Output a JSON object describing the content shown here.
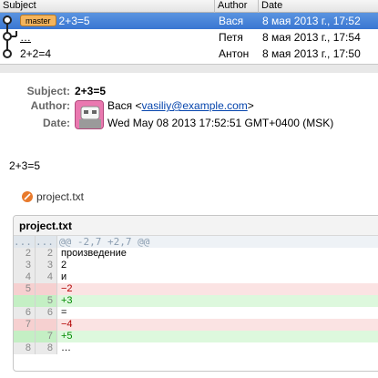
{
  "header": {
    "subject": "Subject",
    "author": "Author",
    "date": "Date"
  },
  "commits": [
    {
      "branch": "master",
      "subject": "2+3=5",
      "author": "Вася",
      "date": "8 мая 2013 г., 17:52"
    },
    {
      "subject": "…",
      "author": "Петя",
      "date": "8 мая 2013 г., 17:54"
    },
    {
      "subject": "2+2=4",
      "author": "Антон",
      "date": "8 мая 2013 г., 17:50"
    }
  ],
  "details": {
    "subject_label": "Subject:",
    "subject": "2+3=5",
    "author_label": "Author:",
    "author_name": "Вася <",
    "author_email": "vasiliy@example.com",
    "author_close": ">",
    "date_label": "Date:",
    "date": "Wed May 08 2013 17:52:51 GMT+0400 (MSK)"
  },
  "message": "2+3=5",
  "file": {
    "name": "project.txt",
    "title": "project.txt"
  },
  "diff": {
    "hunk_left": "...",
    "hunk_right": "...",
    "hunk_header": "@@ -2,7 +2,7 @@",
    "lines": [
      {
        "type": "ctx",
        "old": "2",
        "new": "2",
        "text": " произведение"
      },
      {
        "type": "ctx",
        "old": "3",
        "new": "3",
        "text": " 2"
      },
      {
        "type": "ctx",
        "old": "4",
        "new": "4",
        "text": " и"
      },
      {
        "type": "del",
        "old": "5",
        "new": "",
        "text": "−2"
      },
      {
        "type": "add",
        "old": "",
        "new": "5",
        "text": "+3"
      },
      {
        "type": "ctx",
        "old": "6",
        "new": "6",
        "text": " ="
      },
      {
        "type": "del",
        "old": "7",
        "new": "",
        "text": "−4"
      },
      {
        "type": "add",
        "old": "",
        "new": "7",
        "text": "+5"
      },
      {
        "type": "ctx",
        "old": "8",
        "new": "8",
        "text": " …"
      }
    ]
  },
  "colors": {
    "selection": "#3a76d2",
    "branch_badge": "#f4b45c",
    "deleted": "#b20000",
    "added": "#008a00"
  }
}
